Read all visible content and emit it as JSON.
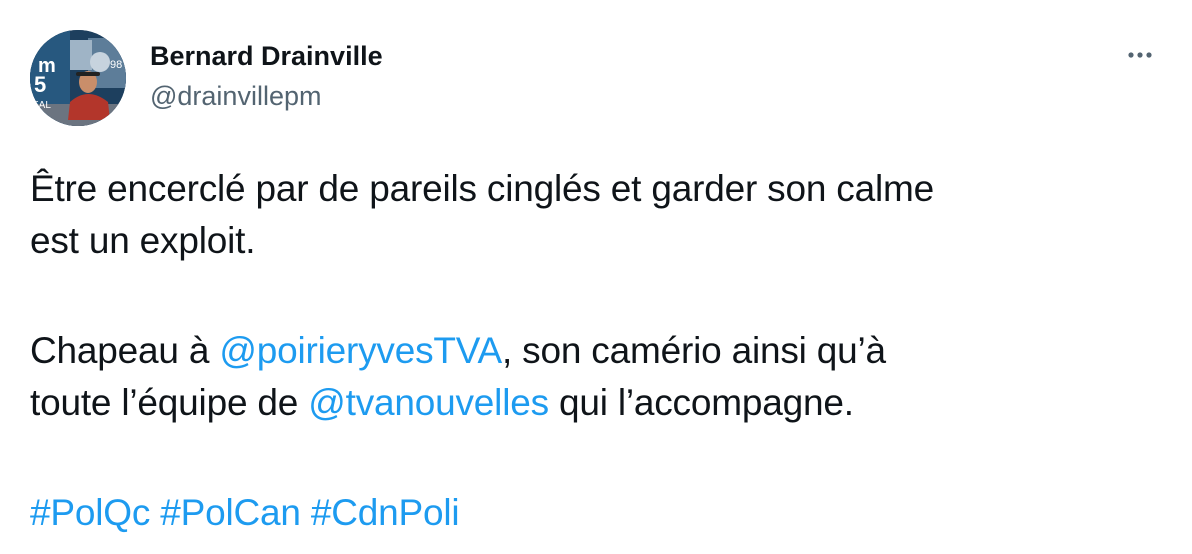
{
  "author": {
    "display_name": "Bernard Drainville",
    "handle": "@drainvillepm"
  },
  "tweet": {
    "p1_line1": "Être encerclé par de pareils cinglés et garder son calme",
    "p1_line2": "est un exploit.",
    "p2_pre": "Chapeau à ",
    "mention1": "@poirieryvesTVA",
    "p2_mid": ", son camério ainsi qu’à",
    "p3_pre": "toute l’équipe de ",
    "mention2": "@tvanouvelles",
    "p3_post": " qui l’accompagne.",
    "hashtags": [
      "#PolQc",
      "#PolCan",
      "#CdnPoli"
    ]
  },
  "icons": {
    "avatar": "profile-photo",
    "more": "more-options-icon"
  },
  "colors": {
    "text": "#0f1419",
    "secondary": "#536471",
    "link": "#1d9bf0",
    "background": "#ffffff"
  }
}
